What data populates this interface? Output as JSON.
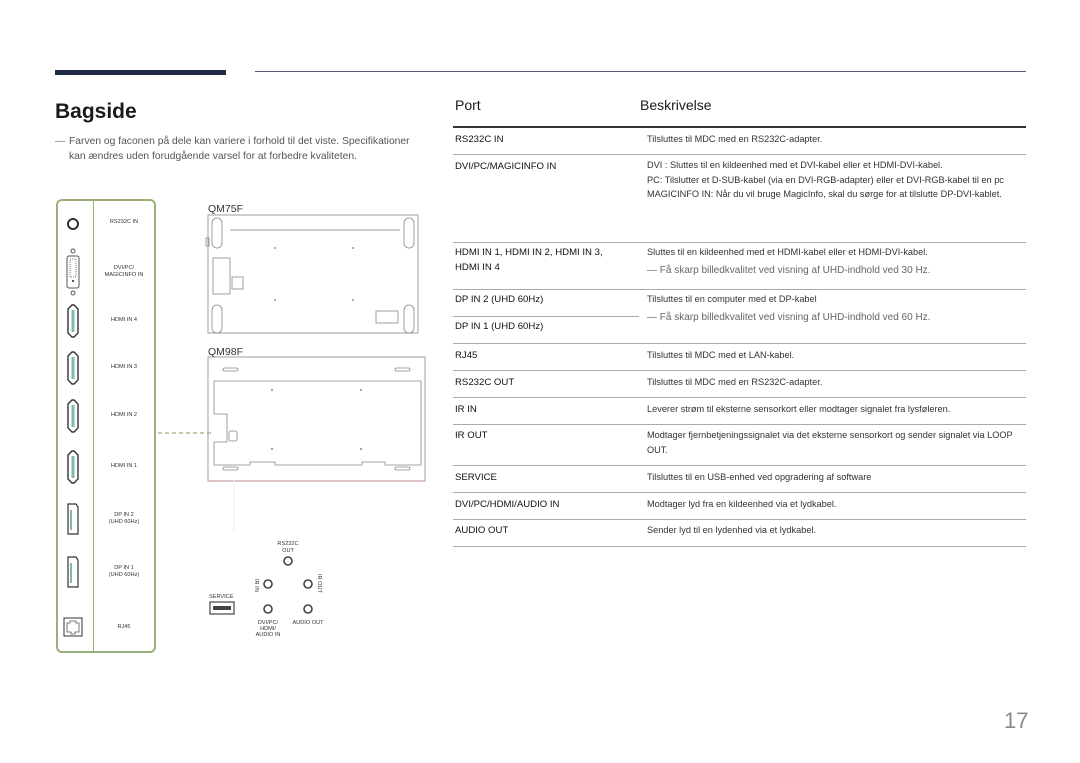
{
  "page": {
    "title": "Bagside",
    "note": "Farven og faconen på dele kan variere i forhold til det viste. Specifikationer kan ændres uden forudgående varsel for at forbedre kvaliteten.",
    "note_dash": "―",
    "page_number": "17"
  },
  "diagram": {
    "models": [
      "QM75F",
      "QM98F"
    ],
    "panel_ports": [
      {
        "label": "RS232C IN",
        "icon": "audio-jack-icon"
      },
      {
        "label": "DVI/PC/\nMAGICINFO IN",
        "icon": "dvi-port-icon"
      },
      {
        "label": "HDMI IN 4",
        "icon": "hdmi-port-icon"
      },
      {
        "label": "HDMI IN 3",
        "icon": "hdmi-port-icon"
      },
      {
        "label": "HDMI IN 2",
        "icon": "hdmi-port-icon"
      },
      {
        "label": "HDMI IN 1",
        "icon": "hdmi-port-icon"
      },
      {
        "label": "DP IN 2\n(UHD 60Hz)",
        "icon": "displayport-icon"
      },
      {
        "label": "DP IN 1\n(UHD 60Hz)",
        "icon": "displayport-icon"
      },
      {
        "label": "RJ45",
        "icon": "rj45-port-icon"
      }
    ],
    "lower_ports": {
      "rs232c_out": "RS232C\nOUT",
      "ir_in": "IR IN",
      "ir_out": "IR OUT",
      "service": "SERVICE",
      "dvi_audio_in": "DVI/PC/\nHDMI/\nAUDIO IN",
      "audio_out": "AUDIO OUT"
    },
    "accent_color": "#9ab07a"
  },
  "table": {
    "headers": {
      "port": "Port",
      "description": "Beskrivelse"
    },
    "rows": [
      {
        "port": "RS232C IN",
        "desc": [
          "Tilsluttes til MDC med en RS232C-adapter."
        ]
      },
      {
        "port": "DVI/PC/MAGICINFO IN",
        "desc": [
          "DVI : Sluttes til en kildeenhed med et DVI-kabel eller et HDMI-DVI-kabel.",
          "PC: Tilslutter et D-SUB-kabel (via en DVI-RGB-adapter) eller et DVI-RGB-kabel til en pc",
          "MAGICINFO IN: Når du vil bruge MagicInfo, skal du sørge for at tilslutte DP-DVI-kablet."
        ]
      },
      {
        "port": "HDMI IN 1, HDMI IN 2, HDMI IN 3, HDMI IN 4",
        "desc": [
          "Sluttes til en kildeenhed med et HDMI-kabel eller et HDMI-DVI-kabel."
        ],
        "sub": "― Få skarp billedkvalitet ved visning af UHD-indhold ved 30 Hz."
      },
      {
        "port": "DP IN 2 (UHD 60Hz)",
        "port2": "DP IN 1 (UHD 60Hz)",
        "desc": [
          "Tilsluttes til en computer med et DP-kabel"
        ],
        "sub": "― Få skarp billedkvalitet ved visning af UHD-indhold ved 60 Hz."
      },
      {
        "port": "RJ45",
        "desc": [
          "Tilsluttes til MDC med et LAN-kabel."
        ]
      },
      {
        "port": "RS232C OUT",
        "desc": [
          "Tilsluttes til MDC med en RS232C-adapter."
        ]
      },
      {
        "port": "IR IN",
        "desc": [
          "Leverer strøm til eksterne sensorkort eller modtager signalet fra lysføleren."
        ]
      },
      {
        "port": "IR OUT",
        "desc": [
          "Modtager fjernbetjeningssignalet via det eksterne sensorkort og sender signalet via LOOP OUT."
        ]
      },
      {
        "port": "SERVICE",
        "desc": [
          "Tilsluttes til en USB-enhed ved opgradering af software"
        ]
      },
      {
        "port": "DVI/PC/HDMI/AUDIO IN",
        "desc": [
          "Modtager lyd fra en kildeenhed via et lydkabel."
        ]
      },
      {
        "port": "AUDIO OUT",
        "desc": [
          "Sender lyd til en lydenhed via et lydkabel."
        ]
      }
    ]
  }
}
